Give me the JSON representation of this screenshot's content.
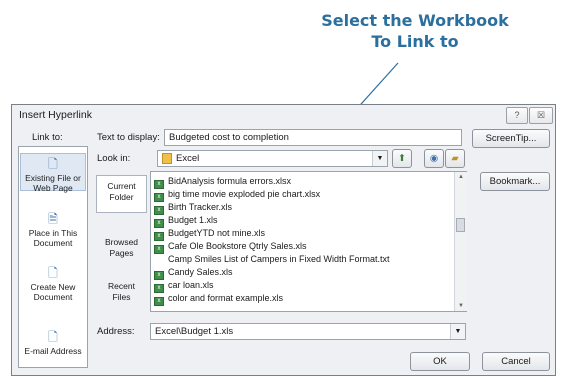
{
  "callout": {
    "line1": "Select the Workbook",
    "line2": "To Link to"
  },
  "dialog": {
    "title": "Insert Hyperlink",
    "help": "?",
    "close": "☒",
    "link_to_label": "Link to:",
    "text_to_display_label": "Text to display:",
    "text_to_display_value": "Budgeted cost to completion",
    "screentip_label": "ScreenTip...",
    "look_in_label": "Look in:",
    "look_in_value": "Excel",
    "bookmark_label": "Bookmark...",
    "address_label": "Address:",
    "address_value": "Excel\\Budget 1.xls",
    "ok_label": "OK",
    "cancel_label": "Cancel",
    "sidebar": [
      {
        "l1": "Existing File or",
        "l2": "Web Page"
      },
      {
        "l1": "Place in This",
        "l2": "Document"
      },
      {
        "l1": "Create New",
        "l2": "Document"
      },
      {
        "l1": "E-mail Address",
        "l2": ""
      }
    ],
    "midnav": [
      {
        "l1": "Current",
        "l2": "Folder"
      },
      {
        "l1": "Browsed",
        "l2": "Pages"
      },
      {
        "l1": "Recent",
        "l2": "Files"
      }
    ],
    "files": [
      {
        "name": "BidAnalysis formula errors.xlsx",
        "icon": true
      },
      {
        "name": "big time movie exploded pie chart.xlsx",
        "icon": true
      },
      {
        "name": "Birth Tracker.xls",
        "icon": true
      },
      {
        "name": "Budget 1.xls",
        "icon": true
      },
      {
        "name": "BudgetYTD not mine.xls",
        "icon": true
      },
      {
        "name": "Cafe Ole Bookstore Qtrly Sales.xls",
        "icon": true
      },
      {
        "name": "Camp Smiles List of Campers in Fixed Width Format.txt",
        "icon": false
      },
      {
        "name": "Candy Sales.xls",
        "icon": true
      },
      {
        "name": "car loan.xls",
        "icon": true
      },
      {
        "name": "color and format example.xls",
        "icon": true
      }
    ]
  }
}
